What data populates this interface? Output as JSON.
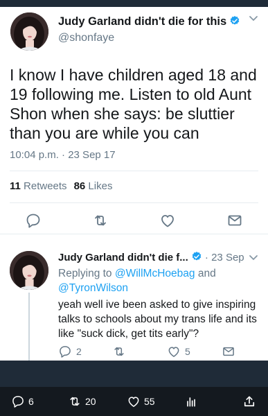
{
  "main_tweet": {
    "name": "Judy Garland didn't die for this",
    "handle": "@shonfaye",
    "text": "I know I have children aged 18 and 19 following me. Listen to old Aunt Shon when she says: be sluttier than you are while you can",
    "timestamp": "10:04 p.m. · 23 Sep 17",
    "retweets_count": "11",
    "retweets_label": "Retweets",
    "likes_count": "86",
    "likes_label": "Likes",
    "icons": {
      "verified": "verified-badge-icon",
      "caret": "chevron-down-icon",
      "reply": "reply-icon",
      "retweet": "retweet-icon",
      "like": "heart-icon",
      "message": "envelope-icon"
    }
  },
  "reply_tweet": {
    "name": "Judy Garland didn't die f...",
    "date": "23 Sep",
    "replying_prefix": "Replying to",
    "mention1": "@WillMcHoebag",
    "and": "and",
    "mention2": "@TyronWilson",
    "text": "yeah well ive been asked to give inspiring talks to schools about my trans life and its like \"suck dick, get tits early\"?",
    "reply_count": "2",
    "like_count": "5"
  },
  "bottom_bar": {
    "replies": "6",
    "retweets": "20",
    "likes": "55",
    "icons": [
      "reply-icon",
      "retweet-icon",
      "heart-icon",
      "analytics-icon",
      "share-icon"
    ]
  },
  "colors": {
    "accent": "#1da1f2",
    "text": "#14171a",
    "muted": "#657786",
    "dark_bg": "#1f2b38"
  }
}
